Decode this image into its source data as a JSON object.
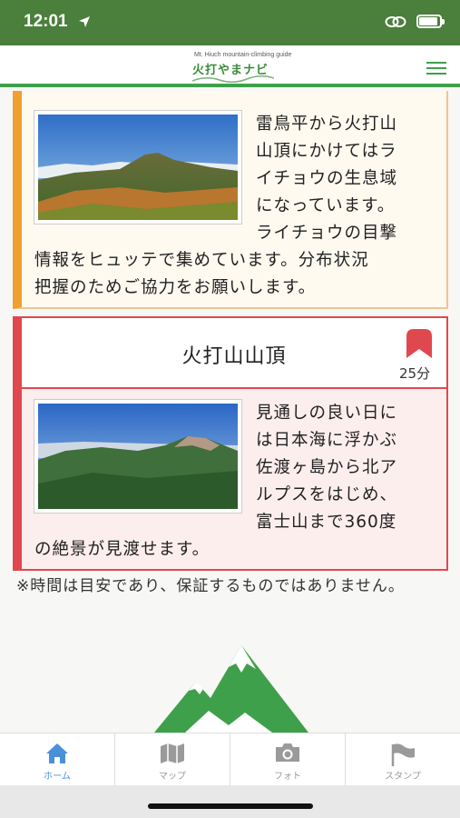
{
  "status_bar": {
    "time": "12:01"
  },
  "header": {
    "logo_subtitle": "Mt. Hiuch mountain-climbing guide",
    "logo_title": "火打やまナビ"
  },
  "card_raicho": {
    "text_lines_right": [
      "雷鳥平から火打山",
      "山頂にかけてはラ",
      "イチョウの生息域",
      "になっています。",
      "ライチョウの目撃"
    ],
    "text_lines_full": [
      "情報をヒュッテで集めています。分布状況",
      "把握のためご協力をお願いします。"
    ]
  },
  "card_summit": {
    "title": "火打山山頂",
    "duration": "25分",
    "text_lines_right": [
      "見通しの良い日に",
      "は日本海に浮かぶ",
      "佐渡ヶ島から北ア",
      "ルプスをはじめ、",
      "富士山まで360度"
    ],
    "text_lines_full": [
      "の絶景が見渡せます。"
    ]
  },
  "note": "※時間は目安であり、保証するものではありません。",
  "tabs": [
    {
      "label": "ホーム",
      "icon": "home-icon",
      "active": true
    },
    {
      "label": "マップ",
      "icon": "map-icon",
      "active": false
    },
    {
      "label": "フォト",
      "icon": "camera-icon",
      "active": false
    },
    {
      "label": "スタンプ",
      "icon": "flag-icon",
      "active": false
    }
  ],
  "colors": {
    "status_bar": "#4a7f3c",
    "header_accent": "#3fa04b",
    "card_orange_accent": "#f0a030",
    "card_red_accent": "#e0484f",
    "tab_active": "#4a90d9"
  },
  "battery_level": 0.9
}
